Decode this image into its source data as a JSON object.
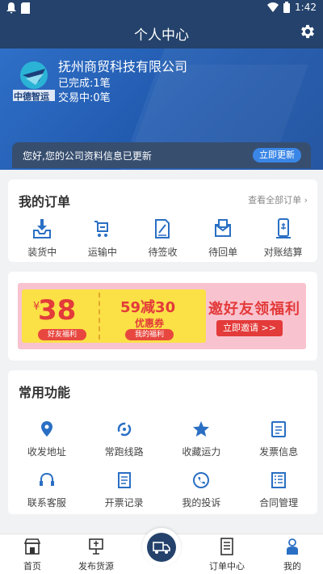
{
  "status_bar": {
    "time": "1:42"
  },
  "header": {
    "title": "个人中心"
  },
  "profile": {
    "company": "抚州商贸科技有限公司",
    "completed": "已完成:1笔",
    "trading": "交易中:0笔",
    "logo_text": "中德智运"
  },
  "notice": {
    "text": "您好,您的公司资料信息已更新",
    "button": "立即更新"
  },
  "orders": {
    "title": "我的订单",
    "view_all": "查看全部订单 ›",
    "items": [
      "装货中",
      "运输中",
      "待签收",
      "待回单",
      "对账结算"
    ]
  },
  "banner": {
    "yen": "¥",
    "amount": "38",
    "tag1": "好友福利",
    "promo": "59减30",
    "coupon": "优惠券",
    "tag2": "我的福利",
    "headline": "邀好友领福利",
    "invite": "立即邀请 >>"
  },
  "functions": {
    "title": "常用功能",
    "items": [
      "收发地址",
      "常跑线路",
      "收藏运力",
      "发票信息",
      "联系客服",
      "开票记录",
      "我的投诉",
      "合同管理"
    ]
  },
  "tabbar": {
    "items": [
      "首页",
      "发布货源",
      "订单中心",
      "我的"
    ]
  },
  "colors": {
    "primary": "#24426b",
    "accent": "#3a86e6",
    "promo_red": "#e33a3a"
  }
}
